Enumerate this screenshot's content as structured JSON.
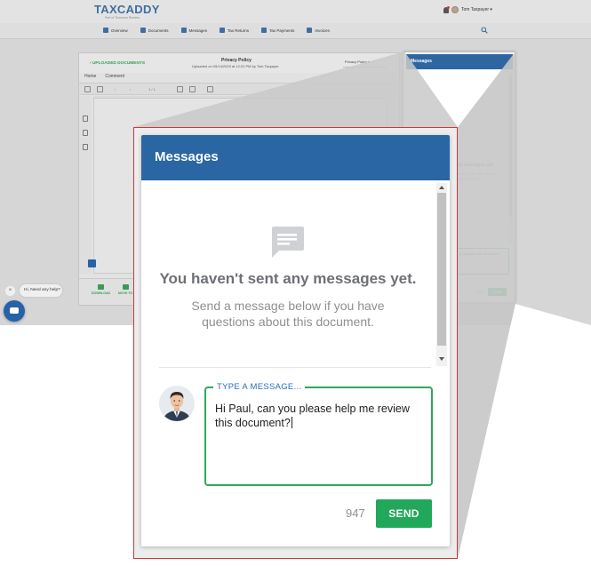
{
  "app": {
    "logo": "TAXCADDY",
    "logo_sub": "Part of Thomson Reuters",
    "user_name": "Tom Taxpayer ▾",
    "nav": [
      "Overview",
      "Documents",
      "Messages",
      "Tax Returns",
      "Tax Payments",
      "Invoices"
    ]
  },
  "document": {
    "back_label": "UPLOADED DOCUMENTS",
    "title": "Privacy Policy",
    "subtitle": "Uploaded on 09/14/2023 at 12:22 PM by Tom Taxpayer",
    "select_value": "Privacy Policy",
    "tabs": [
      "Home",
      "Comment"
    ],
    "page_indicator": "1 / 1",
    "bottom_actions": [
      "DOWNLOAD",
      "MOVE TO"
    ]
  },
  "help": {
    "close_glyph": "×",
    "bubble_text": "Hi, Need any help?"
  },
  "messages_small": {
    "title": "Messages",
    "empty_title": "any messages yet.",
    "empty_sub": "elow if you have about this document.",
    "typed_text": "p, please help me review",
    "char_count": "947",
    "send_label": "SEND"
  },
  "messages": {
    "title": "Messages",
    "empty_title": "You haven't sent any messages yet.",
    "empty_subtitle": "Send a message below if you have questions about this document.",
    "field_label": "TYPE A MESSAGE...",
    "message_text": "Hi Paul, can you please help me review this document?",
    "char_count": "947",
    "send_label": "SEND"
  },
  "colors": {
    "header_blue": "#2a66a4",
    "send_green": "#22a85a",
    "field_border_green": "#2fa85a",
    "label_blue": "#2b6fb6",
    "callout_red": "#c9393b"
  },
  "icons": {
    "empty_state": "chat-bubble-icon",
    "scroll_up": "triangle-up-icon",
    "scroll_down": "triangle-down-icon"
  }
}
